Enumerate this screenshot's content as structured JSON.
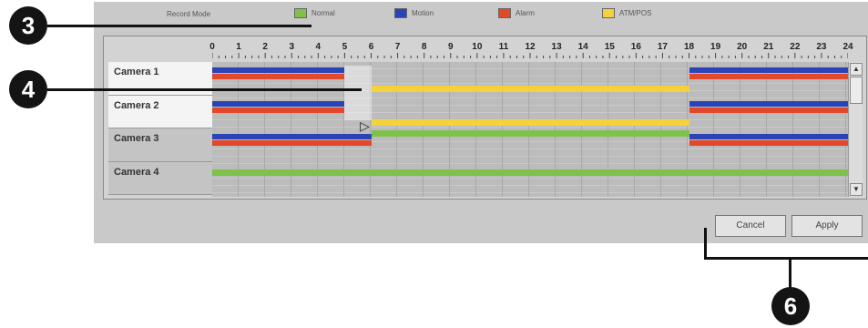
{
  "legend": {
    "title": "Record Mode",
    "items": [
      {
        "label": "Normal",
        "color": "#7ec24a"
      },
      {
        "label": "Motion",
        "color": "#2a44b8"
      },
      {
        "label": "Alarm",
        "color": "#e2482a"
      },
      {
        "label": "ATM/POS",
        "color": "#f3d23c"
      }
    ]
  },
  "hours": [
    "0",
    "1",
    "2",
    "3",
    "4",
    "5",
    "6",
    "7",
    "8",
    "9",
    "10",
    "11",
    "12",
    "13",
    "14",
    "15",
    "16",
    "17",
    "18",
    "19",
    "20",
    "21",
    "22",
    "23",
    "24"
  ],
  "cameras": [
    {
      "label": "Camera 1",
      "segments": [
        {
          "mode": "motion",
          "start": 0,
          "end": 5
        },
        {
          "mode": "alarm",
          "start": 0,
          "end": 5
        },
        {
          "mode": "atm",
          "start": 6,
          "end": 18
        },
        {
          "mode": "motion",
          "start": 18,
          "end": 24
        },
        {
          "mode": "alarm",
          "start": 18,
          "end": 24
        }
      ]
    },
    {
      "label": "Camera 2",
      "segments": [
        {
          "mode": "motion",
          "start": 0,
          "end": 5
        },
        {
          "mode": "alarm",
          "start": 0,
          "end": 5
        },
        {
          "mode": "atm",
          "start": 6,
          "end": 18
        },
        {
          "mode": "motion",
          "start": 18,
          "end": 24
        },
        {
          "mode": "alarm",
          "start": 18,
          "end": 24
        }
      ]
    },
    {
      "label": "Camera 3",
      "segments": [
        {
          "mode": "motion",
          "start": 0,
          "end": 6
        },
        {
          "mode": "alarm",
          "start": 0,
          "end": 6
        },
        {
          "mode": "normal",
          "start": 6,
          "end": 18
        },
        {
          "mode": "motion",
          "start": 18,
          "end": 24
        },
        {
          "mode": "alarm",
          "start": 18,
          "end": 24
        }
      ]
    },
    {
      "label": "Camera 4",
      "segments": [
        {
          "mode": "normal",
          "start": 0,
          "end": 24
        }
      ]
    }
  ],
  "buttons": {
    "cancel": "Cancel",
    "apply": "Apply"
  },
  "callouts": {
    "c3": "3",
    "c4": "4",
    "c6": "6"
  }
}
